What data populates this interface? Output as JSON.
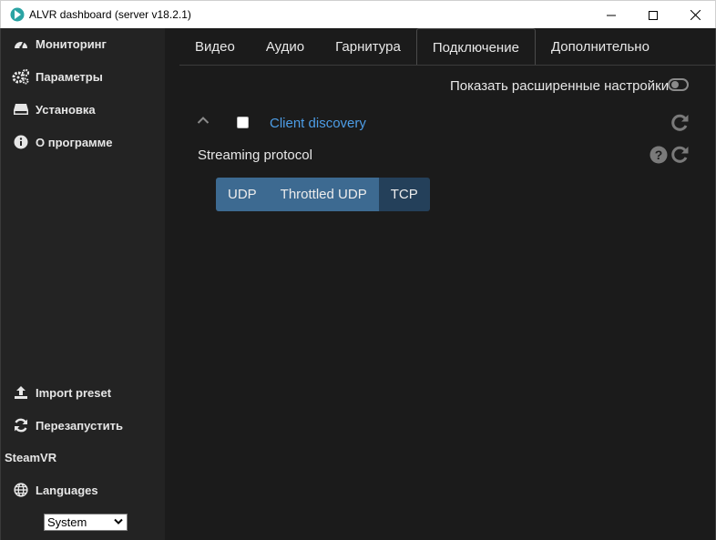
{
  "window": {
    "title": "ALVR dashboard (server v18.2.1)",
    "controls": {
      "minimize": "minimize-icon",
      "maximize": "maximize-icon",
      "close": "close-icon"
    }
  },
  "sidebar": {
    "items": [
      {
        "label": "Мониторинг",
        "icon": "gauge-icon"
      },
      {
        "label": "Параметры",
        "icon": "gears-icon"
      },
      {
        "label": "Установка",
        "icon": "hdd-icon"
      },
      {
        "label": "О программе",
        "icon": "info-icon"
      }
    ],
    "bottom": {
      "import_label": "Import preset",
      "restart_label": "Перезапустить",
      "steamvr_label": "SteamVR",
      "languages_label": "Languages",
      "language_selected": "System"
    }
  },
  "tabs": [
    {
      "label": "Видео",
      "active": false
    },
    {
      "label": "Аудио",
      "active": false
    },
    {
      "label": "Гарнитура",
      "active": false
    },
    {
      "label": "Подключение",
      "active": true
    },
    {
      "label": "Дополнительно",
      "active": false
    }
  ],
  "settings": {
    "advanced_label": "Показать расширенные настройки",
    "advanced_enabled": false,
    "client_discovery_label": "Client discovery",
    "client_discovery_checked": false,
    "streaming_protocol_label": "Streaming protocol",
    "protocol_options": [
      "UDP",
      "Throttled UDP",
      "TCP"
    ],
    "protocol_selected": "TCP"
  },
  "colors": {
    "background": "#1b1b1b",
    "sidebar": "#232323",
    "link": "#4d9de6",
    "segment_inactive": "#3d6a91",
    "segment_selected": "#24405a"
  }
}
